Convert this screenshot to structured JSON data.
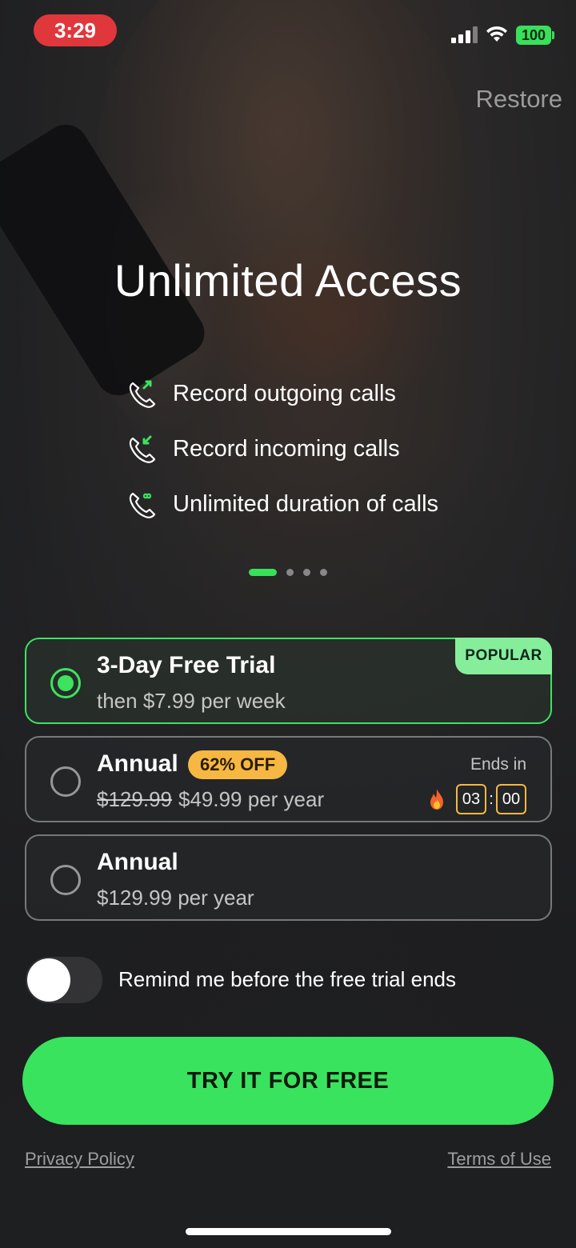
{
  "status_bar": {
    "time": "3:29",
    "battery": "100",
    "accent_time_bg": "#e0373d",
    "battery_color": "#39e05a"
  },
  "header": {
    "restore_label": "Restore"
  },
  "hero": {
    "title": "Unlimited Access",
    "features": [
      {
        "icon": "phone-outgoing-icon",
        "text": "Record outgoing calls"
      },
      {
        "icon": "phone-incoming-icon",
        "text": "Record incoming calls"
      },
      {
        "icon": "phone-infinity-icon",
        "text": "Unlimited duration of calls"
      }
    ],
    "carousel": {
      "pages": 4,
      "active_index": 0
    }
  },
  "plans": [
    {
      "name": "3-Day Free Trial",
      "price": "then $7.99 per week",
      "selected": true,
      "badge": "POPULAR"
    },
    {
      "name": "Annual",
      "discount": "62% OFF",
      "old_price": "$129.99",
      "price": "$49.99 per year",
      "selected": false,
      "ends_in_label": "Ends in",
      "timer": {
        "minutes": "03",
        "seconds": "00",
        "separator": ":"
      }
    },
    {
      "name": "Annual",
      "price": "$129.99 per year",
      "selected": false
    }
  ],
  "reminder": {
    "label": "Remind me before the free trial ends",
    "enabled": false
  },
  "cta": {
    "label": "TRY IT FOR FREE",
    "color": "#3ae35e"
  },
  "footer": {
    "privacy_label": "Privacy Policy",
    "terms_label": "Terms of Use"
  }
}
